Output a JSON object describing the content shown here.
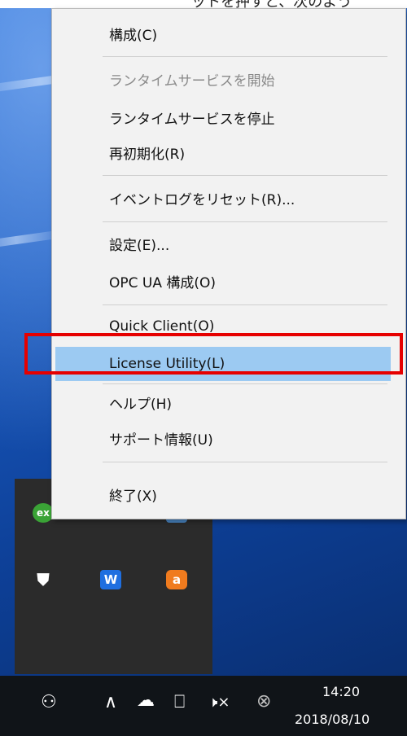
{
  "top_caption": "ットを押すと、次のよう",
  "menu": {
    "items": [
      {
        "label": "構成(C)",
        "state": "enabled"
      },
      {
        "label": "ランタイムサービスを開始",
        "state": "disabled"
      },
      {
        "label": "ランタイムサービスを停止",
        "state": "enabled"
      },
      {
        "label": "再初期化(R)",
        "state": "enabled"
      },
      {
        "label": "イベントログをリセット(R)...",
        "state": "enabled"
      },
      {
        "label": "設定(E)...",
        "state": "enabled"
      },
      {
        "label": "OPC UA 構成(O)",
        "state": "enabled"
      },
      {
        "label": "Quick Client(O)",
        "state": "enabled"
      },
      {
        "label": "License Utility(L)",
        "state": "highlighted"
      },
      {
        "label": "ヘルプ(H)",
        "state": "enabled"
      },
      {
        "label": "サポート情報(U)",
        "state": "enabled"
      },
      {
        "label": "終了(X)",
        "state": "enabled"
      }
    ]
  },
  "tray_overflow": {
    "icons": [
      {
        "name": "ex-app-icon",
        "glyph": "ex",
        "color": "#3aa336"
      },
      {
        "name": "network-tray-icon",
        "glyph": "✶",
        "color": "#6b7280"
      },
      {
        "name": "app-tray-icon",
        "glyph": "▣",
        "color": "#4a88c7"
      },
      {
        "name": "security-shield-icon",
        "glyph": "⛊",
        "color": "#e23b3b"
      },
      {
        "name": "w-app-icon",
        "glyph": "W",
        "color": "#1f6fe0"
      },
      {
        "name": "avast-icon",
        "glyph": "a",
        "color": "#f07b1e"
      }
    ]
  },
  "taskbar": {
    "icons": [
      {
        "name": "people-icon",
        "glyph": "⚇"
      },
      {
        "name": "chevron-up-icon",
        "glyph": "∧"
      },
      {
        "name": "onedrive-cloud-icon",
        "glyph": "☁"
      },
      {
        "name": "network-icon",
        "glyph": "⎕"
      },
      {
        "name": "volume-muted-icon",
        "glyph": "🕨×"
      },
      {
        "name": "error-circle-icon",
        "glyph": "⊗"
      }
    ],
    "time": "14:20",
    "date": "2018/08/10"
  },
  "colors": {
    "highlight": "#9ccaf2",
    "annotation_box": "#e60000",
    "taskbar": "#101418"
  }
}
